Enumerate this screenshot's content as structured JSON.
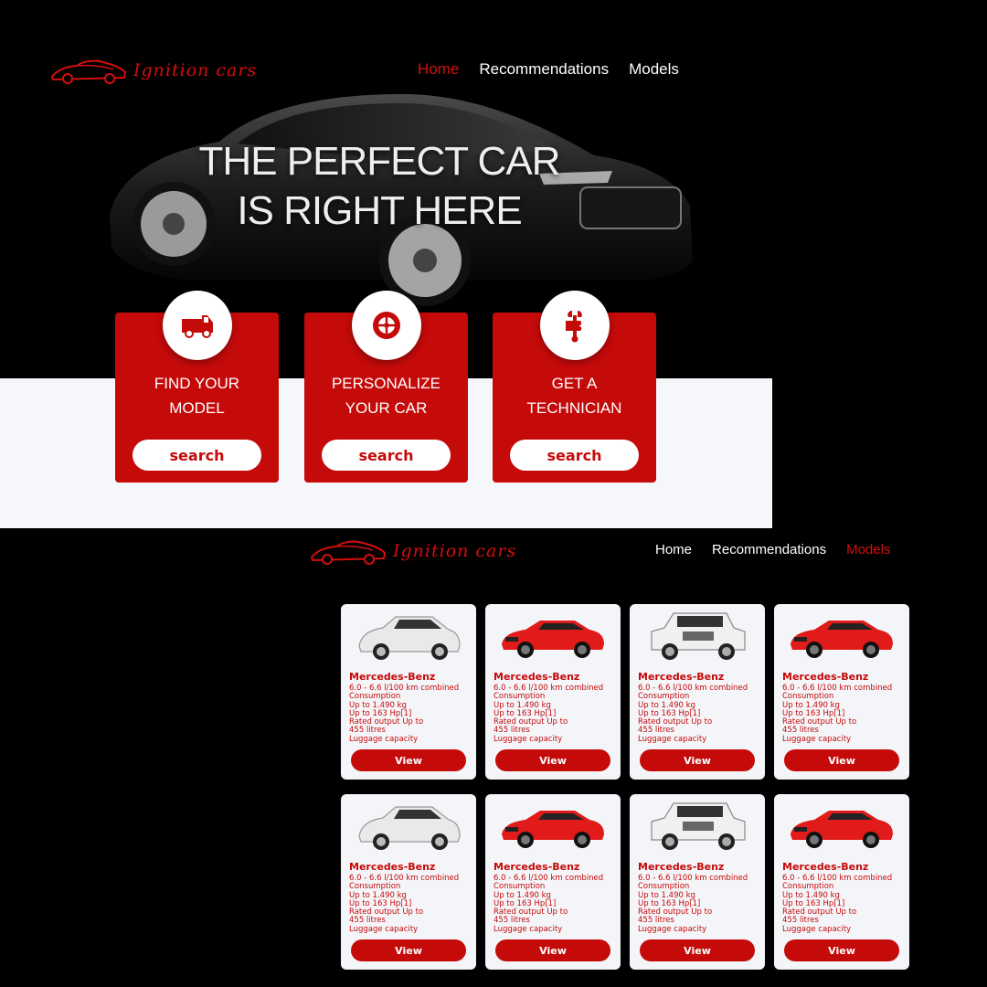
{
  "brand": {
    "name": "Ignition cars",
    "color": "#d50d0d"
  },
  "home_page": {
    "nav": [
      "Home",
      "Recommendations",
      "Models"
    ],
    "active_nav": "Home",
    "hero": {
      "line1": "THE PERFECT CAR",
      "line2": "IS RIGHT HERE"
    },
    "services": [
      {
        "icon": "van-icon",
        "line1": "FIND YOUR",
        "line2": "MODEL",
        "button": "search"
      },
      {
        "icon": "wheel-icon",
        "line1": "PERSONALIZE",
        "line2": "YOUR CAR",
        "button": "search"
      },
      {
        "icon": "wrench-hand-icon",
        "line1": "GET A",
        "line2": "TECHNICIAN",
        "button": "search"
      }
    ]
  },
  "models_page": {
    "nav": [
      "Home",
      "Recommendations",
      "Models"
    ],
    "active_nav": "Models",
    "models": [
      {
        "car": "white-suv",
        "name": "Mercedes-Benz",
        "specs": [
          "6.0 - 6.6 l/100 km combined",
          "Consumption",
          "Up to 1.490 kg",
          "Up to 163 Hp[1]",
          "Rated output Up to",
          "455 litres",
          "Luggage capacity"
        ],
        "button": "View"
      },
      {
        "car": "red-coupe",
        "name": "Mercedes-Benz",
        "specs": [
          "6.0 - 6.6 l/100 km combined",
          "Consumption",
          "Up to 1.490 kg",
          "Up to 163 Hp[1]",
          "Rated output Up to",
          "455 litres",
          "Luggage capacity"
        ],
        "button": "View"
      },
      {
        "car": "white-4x4",
        "name": "Mercedes-Benz",
        "specs": [
          "6.0 - 6.6 l/100 km combined",
          "Consumption",
          "Up to 1.490 kg",
          "Up to 163 Hp[1]",
          "Rated output Up to",
          "455 litres",
          "Luggage capacity"
        ],
        "button": "View"
      },
      {
        "car": "red-coupe",
        "name": "Mercedes-Benz",
        "specs": [
          "6.0 - 6.6 l/100 km combined",
          "Consumption",
          "Up to 1.490 kg",
          "Up to 163 Hp[1]",
          "Rated output Up to",
          "455 litres",
          "Luggage capacity"
        ],
        "button": "View"
      },
      {
        "car": "white-suv",
        "name": "Mercedes-Benz",
        "specs": [
          "6.0 - 6.6 l/100 km combined",
          "Consumption",
          "Up to 1.490 kg",
          "Up to 163 Hp[1]",
          "Rated output Up to",
          "455 litres",
          "Luggage capacity"
        ],
        "button": "View"
      },
      {
        "car": "red-coupe",
        "name": "Mercedes-Benz",
        "specs": [
          "6.0 - 6.6 l/100 km combined",
          "Consumption",
          "Up to 1.490 kg",
          "Up to 163 Hp[1]",
          "Rated output Up to",
          "455 litres",
          "Luggage capacity"
        ],
        "button": "View"
      },
      {
        "car": "white-4x4",
        "name": "Mercedes-Benz",
        "specs": [
          "6.0 - 6.6 l/100 km combined",
          "Consumption",
          "Up to 1.490 kg",
          "Up to 163 Hp[1]",
          "Rated output Up to",
          "455 litres",
          "Luggage capacity"
        ],
        "button": "View"
      },
      {
        "car": "red-coupe",
        "name": "Mercedes-Benz",
        "specs": [
          "6.0 - 6.6 l/100 km combined",
          "Consumption",
          "Up to 1.490 kg",
          "Up to 163 Hp[1]",
          "Rated output Up to",
          "455 litres",
          "Luggage capacity"
        ],
        "button": "View"
      }
    ]
  }
}
